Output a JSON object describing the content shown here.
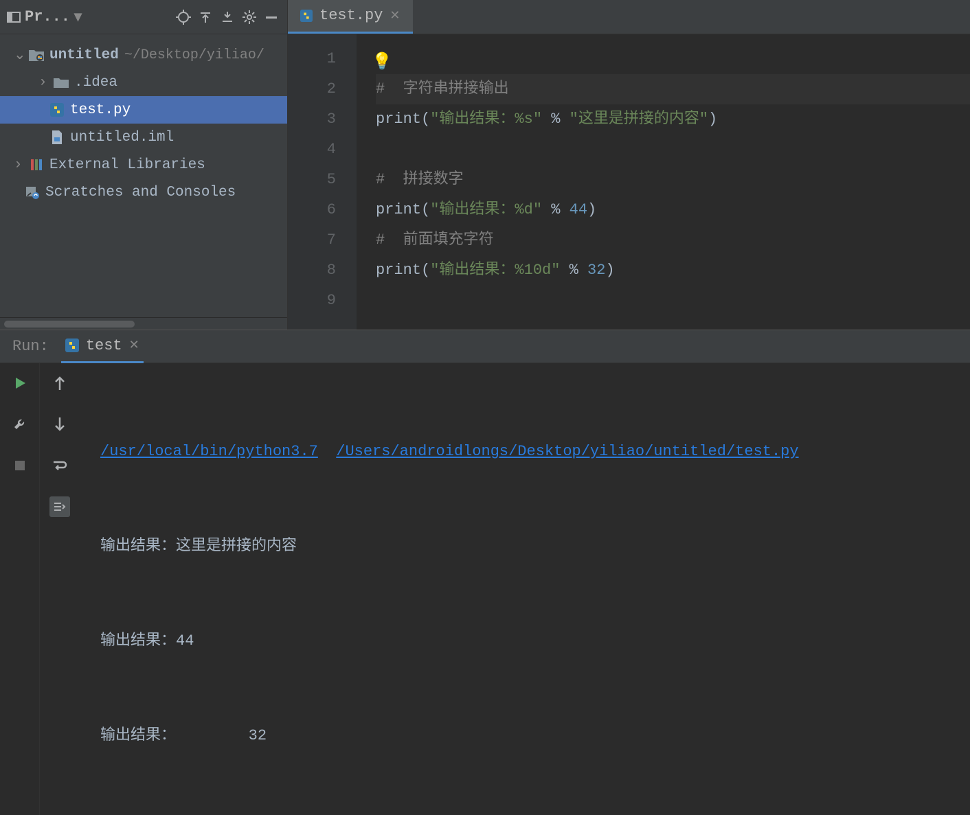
{
  "sidebar": {
    "panel_label": "Pr...",
    "root": {
      "name": "untitled",
      "path": "~/Desktop/yiliao/",
      "expanded": true
    },
    "items": [
      {
        "kind": "folder",
        "name": ".idea",
        "depth": 1,
        "arrow": ">"
      },
      {
        "kind": "py",
        "name": "test.py",
        "depth": 1,
        "selected": true
      },
      {
        "kind": "iml",
        "name": "untitled.iml",
        "depth": 1
      }
    ],
    "external": "External Libraries",
    "scratches": "Scratches and Consoles"
  },
  "editor": {
    "tab_label": "test.py",
    "lines": [
      {
        "n": 1,
        "parts": []
      },
      {
        "n": 2,
        "caret": true,
        "parts": [
          {
            "t": "#  字符串拼接输出",
            "c": "c-comment"
          }
        ]
      },
      {
        "n": 3,
        "parts": [
          {
            "t": "print",
            "c": "c-fn"
          },
          {
            "t": "(",
            "c": "c-paren"
          },
          {
            "t": "\"输出结果：%s\"",
            "c": "c-str"
          },
          {
            "t": " % ",
            "c": "c-op"
          },
          {
            "t": "\"这里是拼接的内容\"",
            "c": "c-str"
          },
          {
            "t": ")",
            "c": "c-paren"
          }
        ]
      },
      {
        "n": 4,
        "parts": []
      },
      {
        "n": 5,
        "parts": [
          {
            "t": "#  拼接数字",
            "c": "c-comment"
          }
        ]
      },
      {
        "n": 6,
        "parts": [
          {
            "t": "print",
            "c": "c-fn"
          },
          {
            "t": "(",
            "c": "c-paren"
          },
          {
            "t": "\"输出结果：%d\"",
            "c": "c-str"
          },
          {
            "t": " % ",
            "c": "c-op"
          },
          {
            "t": "44",
            "c": "c-num"
          },
          {
            "t": ")",
            "c": "c-paren"
          }
        ]
      },
      {
        "n": 7,
        "parts": [
          {
            "t": "#  前面填充字符",
            "c": "c-comment"
          }
        ]
      },
      {
        "n": 8,
        "parts": [
          {
            "t": "print",
            "c": "c-fn"
          },
          {
            "t": "(",
            "c": "c-paren"
          },
          {
            "t": "\"输出结果：%10d\"",
            "c": "c-str"
          },
          {
            "t": " % ",
            "c": "c-op"
          },
          {
            "t": "32",
            "c": "c-num"
          },
          {
            "t": ")",
            "c": "c-paren"
          }
        ]
      },
      {
        "n": 9,
        "parts": []
      }
    ]
  },
  "run": {
    "label": "Run:",
    "tab": "test",
    "cmd_interpreter": "/usr/local/bin/python3.7",
    "cmd_script": "/Users/androidlongs/Desktop/yiliao/untitled/test.py",
    "output": [
      "输出结果：这里是拼接的内容",
      "输出结果：44",
      "输出结果：        32"
    ]
  }
}
